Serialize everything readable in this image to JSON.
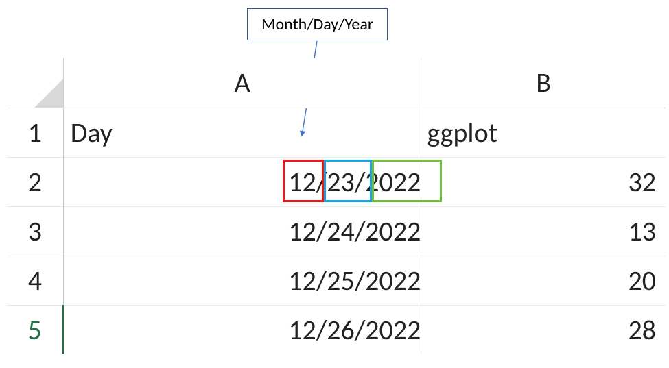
{
  "annotation": {
    "label": "Month/Day/Year"
  },
  "columns": {
    "a": "A",
    "b": "B"
  },
  "rows": [
    "1",
    "2",
    "3",
    "4",
    "5"
  ],
  "header": {
    "a": "Day",
    "b": "ggplot"
  },
  "data": [
    {
      "date": "12/23/2022",
      "value": "32"
    },
    {
      "date": "12/24/2022",
      "value": "13"
    },
    {
      "date": "12/25/2022",
      "value": "20"
    },
    {
      "date": "12/26/2022",
      "value": "28"
    }
  ]
}
